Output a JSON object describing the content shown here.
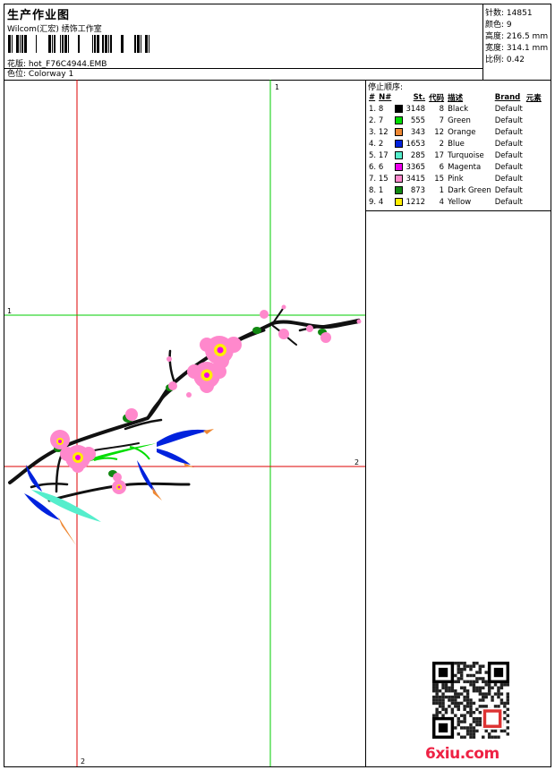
{
  "header": {
    "title": "生产作业图",
    "subtitle": "Wilcom(汇宏) 绣饰工作室",
    "design_label": "花版:",
    "design_file": "hot_F76C4944.EMB",
    "colorway_label": "色位:",
    "colorway": "Colorway 1"
  },
  "stats": [
    {
      "label": "针数:",
      "value": "14851"
    },
    {
      "label": "颜色:",
      "value": "9"
    },
    {
      "label": "高度:",
      "value": "216.5 mm"
    },
    {
      "label": "宽度:",
      "value": "314.1 mm"
    },
    {
      "label": "比例:",
      "value": "0.42"
    }
  ],
  "sequence": {
    "title": "停止顺序:",
    "columns": [
      "#",
      "N#",
      "St.",
      "代码",
      "描述",
      "Brand",
      "元素"
    ],
    "rows": [
      {
        "idx": "1.",
        "n": "8",
        "color": "#000000",
        "st": "3148",
        "code": "8",
        "desc": "Black",
        "brand": "Default"
      },
      {
        "idx": "2.",
        "n": "7",
        "color": "#00dd00",
        "st": "555",
        "code": "7",
        "desc": "Green",
        "brand": "Default"
      },
      {
        "idx": "3.",
        "n": "12",
        "color": "#ee8833",
        "st": "343",
        "code": "12",
        "desc": "Orange",
        "brand": "Default"
      },
      {
        "idx": "4.",
        "n": "2",
        "color": "#0022dd",
        "st": "1653",
        "code": "2",
        "desc": "Blue",
        "brand": "Default"
      },
      {
        "idx": "5.",
        "n": "17",
        "color": "#55eecc",
        "st": "285",
        "code": "17",
        "desc": "Turquoise",
        "brand": "Default"
      },
      {
        "idx": "6.",
        "n": "6",
        "color": "#ee00ee",
        "st": "3365",
        "code": "6",
        "desc": "Magenta",
        "brand": "Default"
      },
      {
        "idx": "7.",
        "n": "15",
        "color": "#ff88cc",
        "st": "3415",
        "code": "15",
        "desc": "Pink",
        "brand": "Default"
      },
      {
        "idx": "8.",
        "n": "1",
        "color": "#118811",
        "st": "873",
        "code": "1",
        "desc": "Dark Green",
        "brand": "Default"
      },
      {
        "idx": "9.",
        "n": "4",
        "color": "#ffee00",
        "st": "1212",
        "code": "4",
        "desc": "Yellow",
        "brand": "Default"
      }
    ]
  },
  "guides": {
    "marker_1": "1",
    "marker_2": "2"
  },
  "logo_text": "6xiu.com",
  "colors": {
    "guide_red": "#dd0000",
    "guide_green": "#00cc00",
    "branch": "#111111",
    "blossom": "#ff88cc",
    "blossom_center": "#ffee00",
    "logo": "#ee2244"
  }
}
